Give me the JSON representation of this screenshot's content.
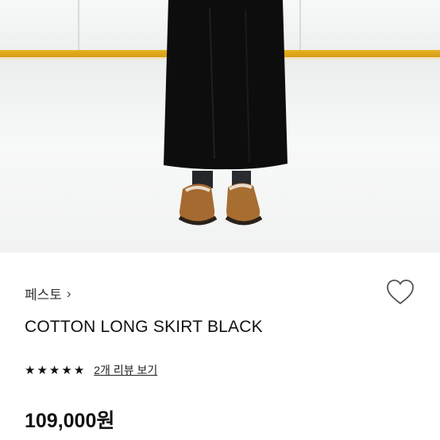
{
  "product": {
    "brand": "페스토",
    "title": "COTTON LONG SKIRT BLACK",
    "rating_stars": 5,
    "review_link": "2개 리뷰 보기",
    "price": "109,000원"
  },
  "icons": {
    "brand_chevron": "chevron-right-icon",
    "wishlist": "heart-outline-icon",
    "star": "star-filled-icon"
  },
  "colors": {
    "accent_rail": "#e0aa1c",
    "skirt": "#0d0d0d",
    "shoe": "#a56a2f"
  }
}
